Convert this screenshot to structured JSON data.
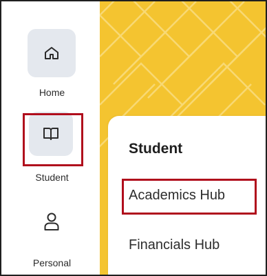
{
  "sidebar": {
    "items": [
      {
        "label": "Home",
        "icon": "home-icon"
      },
      {
        "label": "Student",
        "icon": "book-icon"
      },
      {
        "label": "Personal",
        "icon": "person-icon"
      }
    ]
  },
  "panel": {
    "title": "Student",
    "links": [
      {
        "label": "Academics Hub"
      },
      {
        "label": "Financials Hub"
      }
    ]
  },
  "colors": {
    "banner": "#f4c430",
    "highlight": "#b00d1c",
    "icon_bg": "#e4e8ee"
  }
}
